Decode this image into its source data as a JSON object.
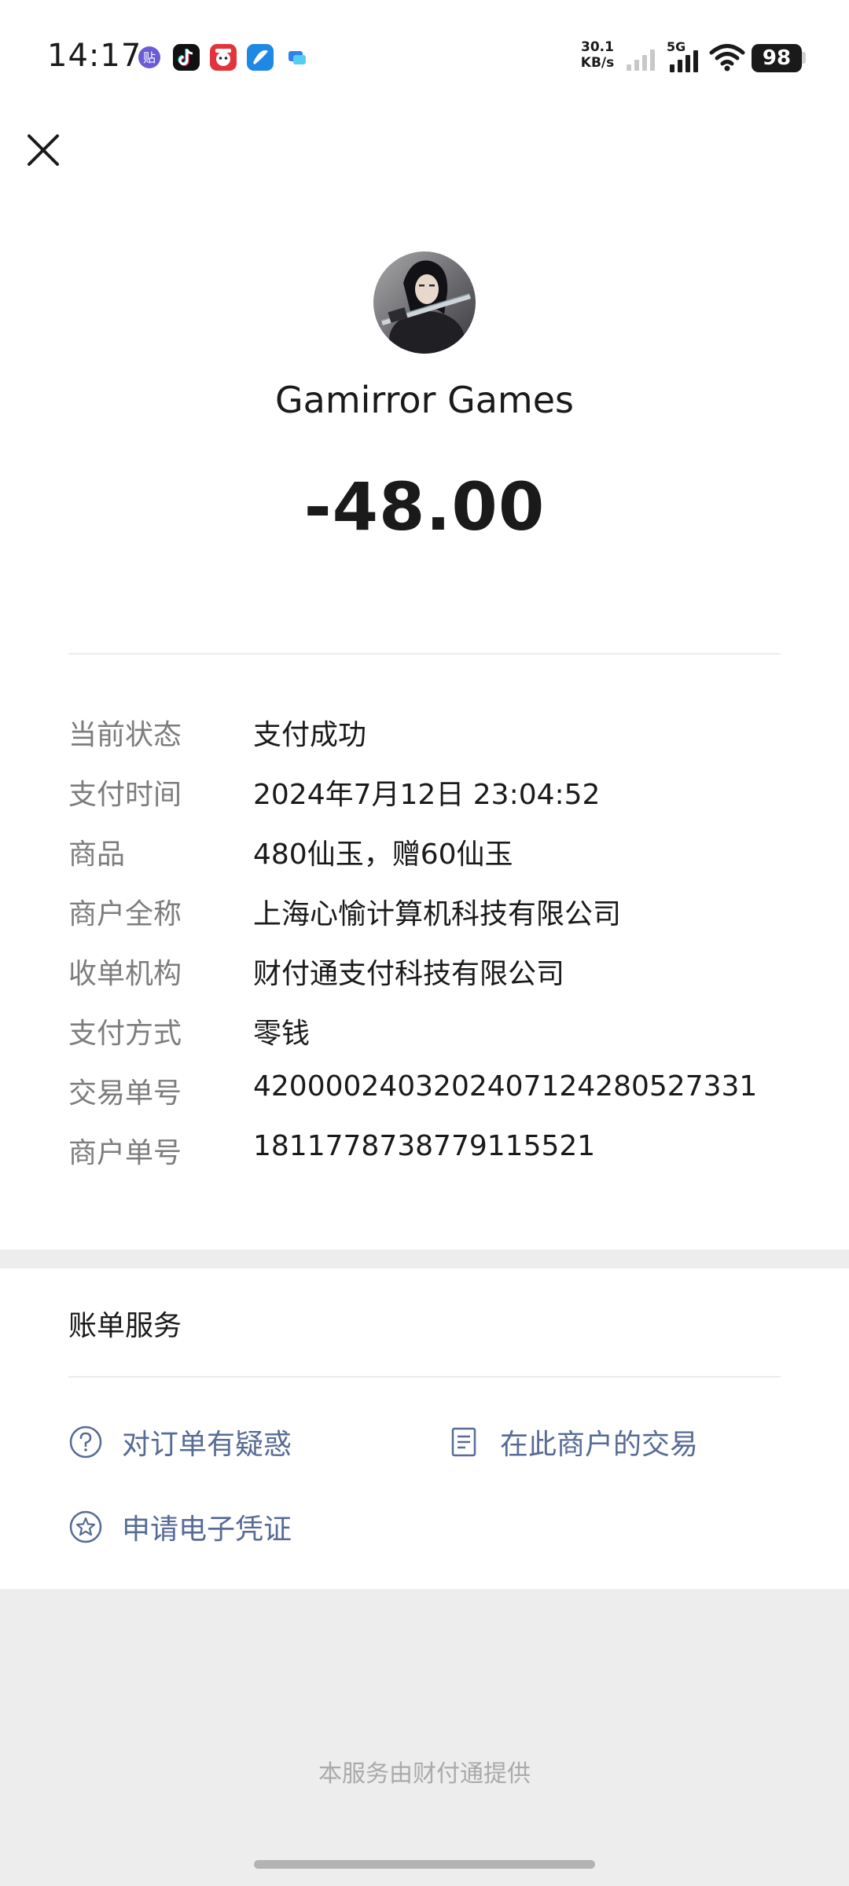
{
  "status_bar": {
    "time": "14:17",
    "net_speed_value": "30.1",
    "net_speed_unit": "KB/s",
    "network_type": "5G",
    "battery": "98",
    "app_icons": [
      "tieba-icon",
      "tiktok-icon",
      "xiaohongshu-icon",
      "browser-icon",
      "message-icon"
    ]
  },
  "header": {
    "close_icon": "close-icon"
  },
  "merchant": {
    "name": "Gamirror Games",
    "amount": "-48.00"
  },
  "details": [
    {
      "label": "当前状态",
      "value": "支付成功"
    },
    {
      "label": "支付时间",
      "value": "2024年7月12日 23:04:52"
    },
    {
      "label": "商品",
      "value": "480仙玉，赠60仙玉"
    },
    {
      "label": "商户全称",
      "value": "上海心愉计算机科技有限公司"
    },
    {
      "label": "收单机构",
      "value": "财付通支付科技有限公司"
    },
    {
      "label": "支付方式",
      "value": "零钱"
    },
    {
      "label": "交易单号",
      "value": "4200002403202407124280527331"
    },
    {
      "label": "商户单号",
      "value": "1811778738779115521"
    }
  ],
  "services": {
    "title": "账单服务",
    "items": [
      {
        "label": "对订单有疑惑",
        "icon": "question-circle-icon"
      },
      {
        "label": "在此商户的交易",
        "icon": "document-list-icon"
      },
      {
        "label": "申请电子凭证",
        "icon": "star-circle-icon"
      }
    ]
  },
  "footer": {
    "text": "本服务由财付通提供"
  },
  "colors": {
    "link": "#576b95",
    "label": "#7d7d7d",
    "text": "#1a1a1a",
    "page_background": "#ededed"
  }
}
